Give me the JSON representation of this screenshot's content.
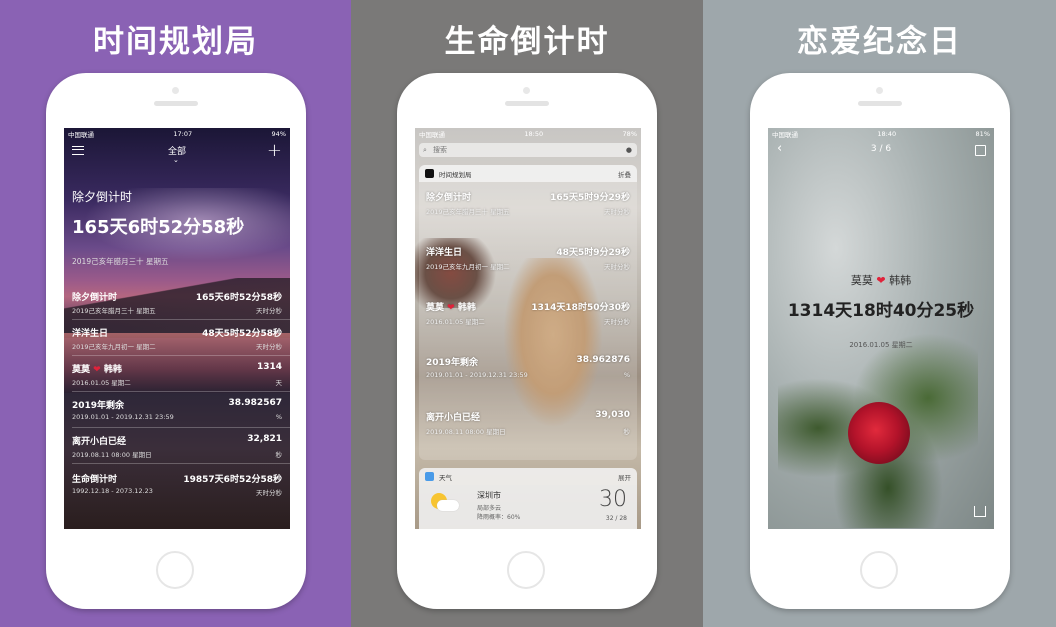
{
  "colors": {
    "panel1_bg": "#8a62b4",
    "panel2_bg": "#7a7978",
    "panel3_bg": "#9ea7ab",
    "heart": "#e0223a"
  },
  "panels": [
    {
      "title": "时间规划局",
      "status": {
        "carrier": "中国联通",
        "time": "17:07",
        "battery": "94%"
      },
      "header": {
        "filter": "全部",
        "menu_icon": "list-icon",
        "add_icon": "plus-icon"
      },
      "featured": {
        "title": "除夕倒计时",
        "value": "165天6时52分58秒",
        "date": "2019己亥年腊月三十  星期五"
      },
      "items": [
        {
          "name": "除夕倒计时",
          "value": "165天6时52分58秒",
          "sub": "2019己亥年腊月三十  星期五",
          "unit": "天时分秒"
        },
        {
          "name": "洋洋生日",
          "value": "48天5时52分58秒",
          "sub": "2019己亥年九月初一  星期二",
          "unit": "天时分秒"
        },
        {
          "name_a": "莫莫",
          "name_b": "韩韩",
          "value": "1314",
          "sub": "2016.01.05  星期二",
          "unit": "天"
        },
        {
          "name": "2019年剩余",
          "value": "38.982567",
          "sub": "2019.01.01 - 2019.12.31 23:59",
          "unit": "%"
        },
        {
          "name": "离开小白已经",
          "value": "32,821",
          "sub": "2019.08.11 08:00  星期日",
          "unit": "秒"
        },
        {
          "name": "生命倒计时",
          "value": "19857天6时52分58秒",
          "sub": "1992.12.18 - 2073.12.23",
          "unit": "天时分秒"
        }
      ]
    },
    {
      "title": "生命倒计时",
      "status": {
        "carrier": "中国联通",
        "time": "18:50",
        "battery": "78%"
      },
      "search_placeholder": "搜索",
      "widget": {
        "app": "时间规划局",
        "action": "折叠"
      },
      "items": [
        {
          "name": "除夕倒计时",
          "value": "165天5时9分29秒",
          "sub": "2019己亥年腊月三十  星期五",
          "unit": "天时分秒"
        },
        {
          "name": "洋洋生日",
          "value": "48天5时9分29秒",
          "sub": "2019己亥年九月初一  星期二",
          "unit": "天时分秒"
        },
        {
          "name_a": "莫莫",
          "name_b": "韩韩",
          "value": "1314天18时50分30秒",
          "sub": "2016.01.05  星期二",
          "unit": "天时分秒"
        },
        {
          "name": "2019年剩余",
          "value": "38.962876",
          "sub": "2019.01.01 - 2019.12.31 23:59",
          "unit": "%"
        },
        {
          "name": "离开小白已经",
          "value": "39,030",
          "sub": "2019.08.11 08:00  星期日",
          "unit": "秒"
        }
      ],
      "weather": {
        "app": "天气",
        "action": "展开",
        "city": "深圳市",
        "cond": "局部多云",
        "rain": "降雨概率：60%",
        "temp": "30",
        "range": "32 / 28"
      }
    },
    {
      "title": "恋爱纪念日",
      "status": {
        "carrier": "中国联通",
        "time": "18:40",
        "battery": "81%"
      },
      "page": "3 / 6",
      "name_a": "莫莫",
      "name_b": "韩韩",
      "value": "1314天18时40分25秒",
      "date": "2016.01.05  星期二"
    }
  ]
}
